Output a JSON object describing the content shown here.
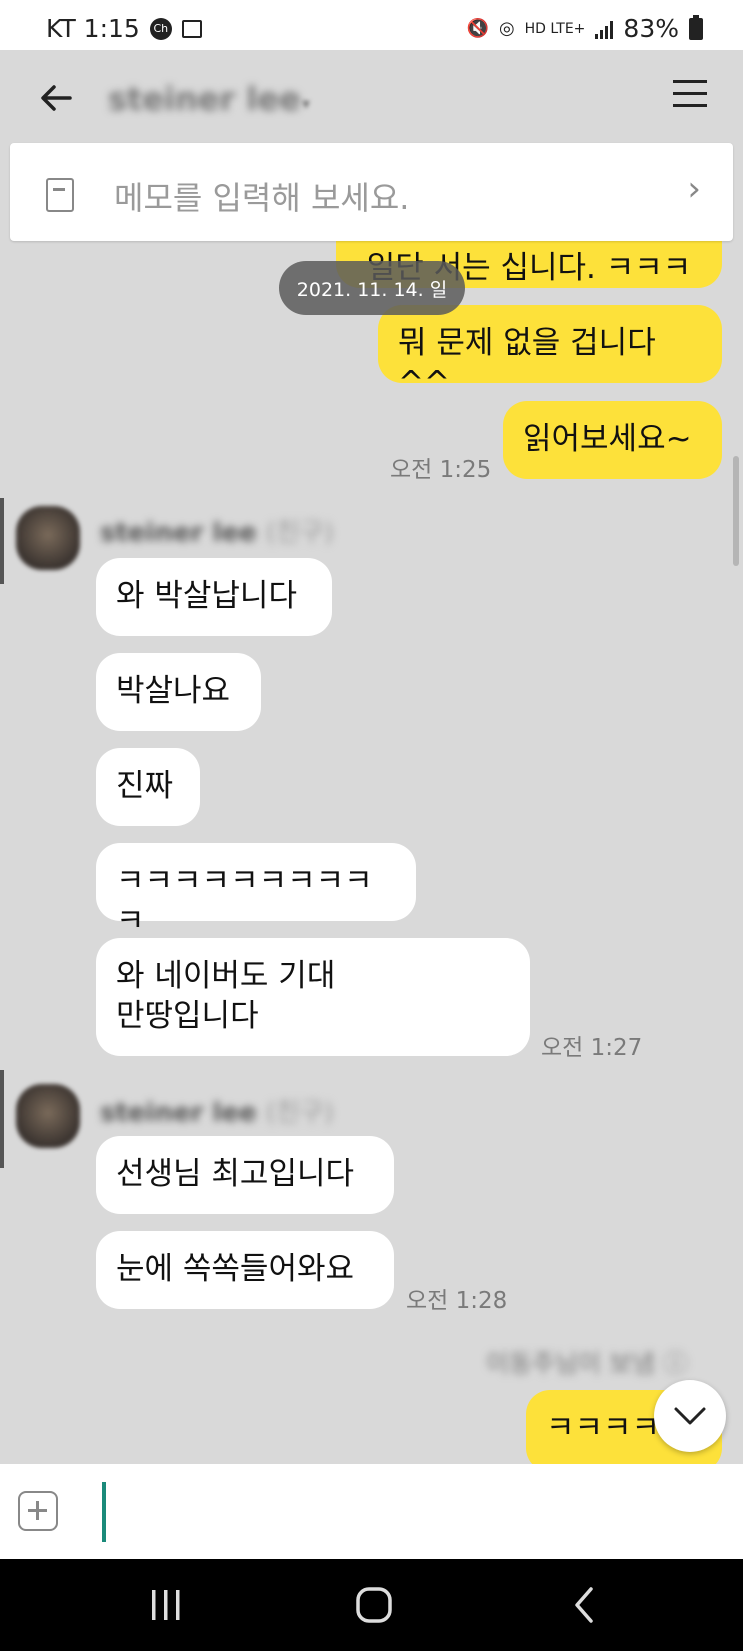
{
  "status_bar": {
    "carrier_time": "KT 1:15",
    "ch_badge": "Ch",
    "network": "HD LTE+",
    "battery": "83%"
  },
  "header": {
    "title": "steiner lee",
    "caret": "▾"
  },
  "memo": {
    "placeholder": "메모를 입력해 보세요.",
    "chevron": "›"
  },
  "date_divider": "2021. 11. 14. 일",
  "messages": {
    "mine_partial_top": "일단 서는 십니다. ㅋㅋㅋ",
    "mine_1": "뭐 문제 없을 겁니다^^",
    "mine_2": "읽어보세요~",
    "mine_2_time": "오전 1:25",
    "group1_sender": "steiner lee",
    "group1_tag": "(친구)",
    "g1_m1": "와 박살납니다",
    "g1_m2": "박살나요",
    "g1_m3": "진짜",
    "g1_m4": "ㅋㅋㅋㅋㅋㅋㅋㅋㅋㅋ",
    "g1_m5": "와 네이버도 기대\n만땅입니다",
    "g1_time": "오전 1:27",
    "group2_sender": "steiner lee",
    "group2_tag": "(친구)",
    "g2_m1": "선생님 최고입니다",
    "g2_m2": "눈에 쏙쏙들어와요",
    "g2_time": "오전 1:28",
    "blurred_note": "이동주님이 보냄 ⓘ",
    "mine_last": "ㅋㅋㅋㅋ"
  },
  "input": {
    "value": ""
  },
  "icons": {
    "back": "back-arrow-icon",
    "menu": "hamburger-menu-icon",
    "memo": "memo-icon",
    "plus": "plus-icon",
    "scroll_down": "chevron-down-icon"
  },
  "colors": {
    "my_bubble": "#fde13a",
    "their_bubble": "#ffffff",
    "chat_bg": "#d9d9d9",
    "caret": "#1a8a7a"
  }
}
